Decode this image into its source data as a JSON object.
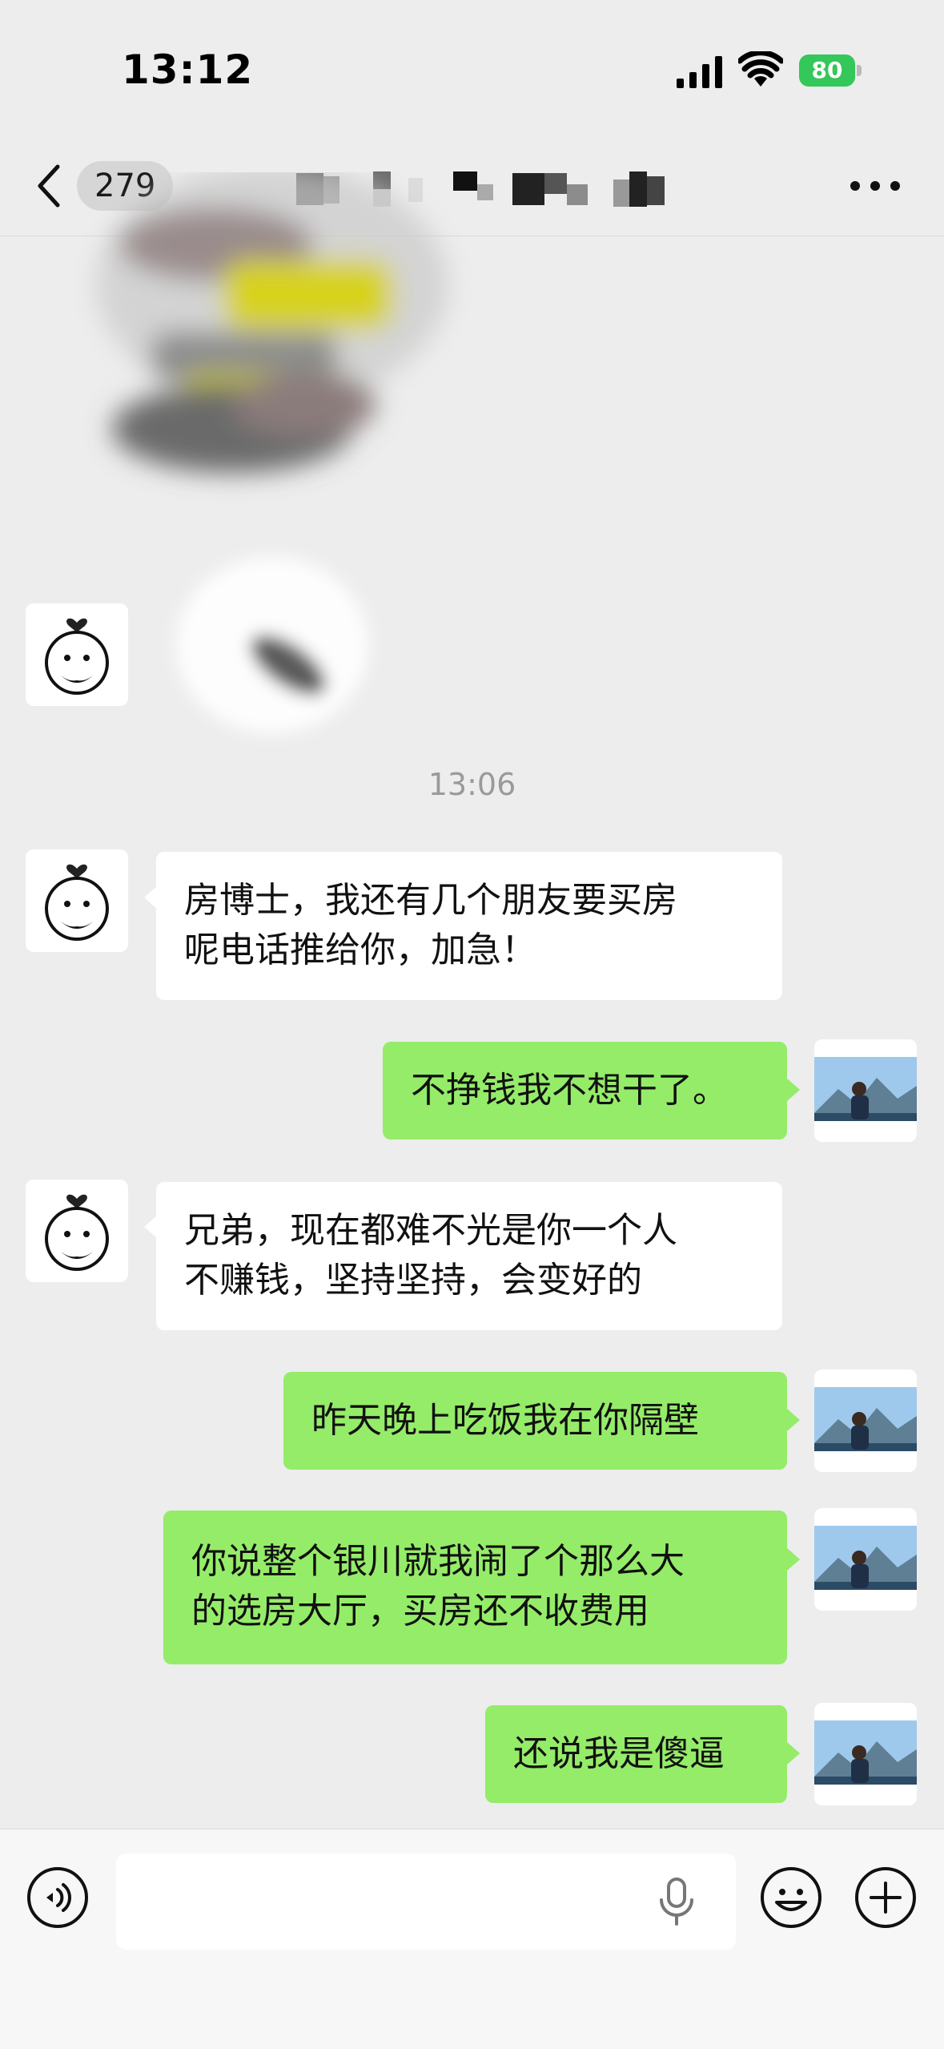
{
  "status_bar": {
    "time": "13:12",
    "battery": "80",
    "signal_icon": "cellular-signal-icon",
    "wifi_icon": "wifi-icon"
  },
  "nav": {
    "back_icon": "chevron-left-icon",
    "unread_count": "279",
    "more_icon": "more-dots-icon"
  },
  "colors": {
    "background": "#ededed",
    "received_bubble": "#ffffff",
    "sent_bubble": "#95ec69",
    "battery": "#34c759"
  },
  "messages": [
    {
      "side": "left",
      "lines": [
        "房博士，我还有几个朋友要买房",
        "呢电话推给你，加急！"
      ]
    },
    {
      "side": "right",
      "lines": [
        "不挣钱我不想干了。"
      ]
    },
    {
      "side": "left",
      "lines": [
        "兄弟，现在都难不光是你一个人",
        "不赚钱，坚持坚持，会变好的"
      ]
    },
    {
      "side": "right",
      "lines": [
        "昨天晚上吃饭我在你隔壁"
      ]
    },
    {
      "side": "right",
      "lines": [
        "你说整个银川就我闹了个那么大",
        "的选房大厅，买房还不收费用"
      ]
    },
    {
      "side": "right",
      "lines": [
        "还说我是傻逼"
      ]
    }
  ],
  "timestamp": "13:06",
  "input_bar": {
    "voice_icon": "voice-toggle-icon",
    "mic_icon": "microphone-icon",
    "emoji_icon": "emoji-icon",
    "plus_icon": "plus-icon"
  }
}
